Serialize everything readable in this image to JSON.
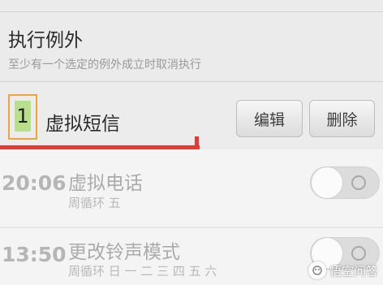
{
  "section": {
    "title": "执行例外",
    "subtitle": "至少有一个选定的例外成立时取消执行"
  },
  "exception": {
    "number": "1",
    "name": "虚拟短信",
    "edit_label": "编辑",
    "delete_label": "删除"
  },
  "alarms": [
    {
      "time": "20:06",
      "name": "虚拟电话",
      "repeat": "周循环 五",
      "enabled": false
    },
    {
      "time": "13:50",
      "name": "更改铃声模式",
      "repeat": "周循环 日 一 二 三 四 五 六",
      "enabled": false
    }
  ],
  "watermark": {
    "text": "悟空问答"
  },
  "colors": {
    "annotation_box": "#f0a43c",
    "annotation_highlight": "#b8e08a",
    "annotation_underline": "#e23b33"
  }
}
